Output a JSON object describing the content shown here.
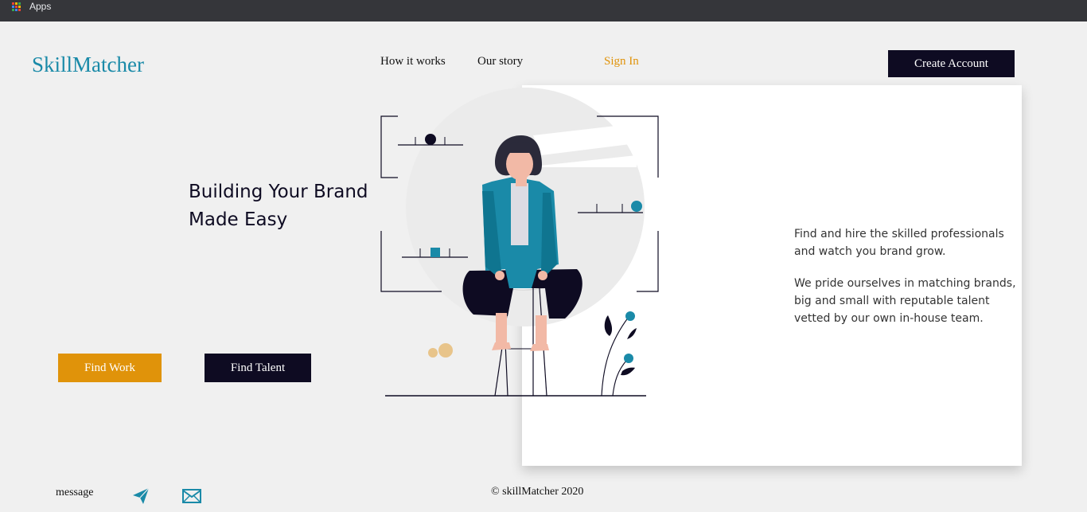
{
  "browser": {
    "apps_label": "Apps"
  },
  "header": {
    "logo": "SkillMatcher",
    "nav": {
      "how": "How it works",
      "story": "Our story",
      "signin": "Sign In"
    },
    "create_account": "Create Account"
  },
  "hero": {
    "headline_1": "Building Your Brand",
    "headline_2": "Made Easy",
    "find_work": "Find Work",
    "find_talent": "Find Talent"
  },
  "panel": {
    "para1": "Find and hire the skilled professionals and watch you brand grow.",
    "para2": "We pride ourselves in matching brands, big and small with reputable talent vetted by our own in-house team."
  },
  "footer": {
    "message": "message",
    "copyright": "© skillMatcher 2020"
  },
  "colors": {
    "brand_teal": "#1a8aa8",
    "accent_orange": "#e0930a",
    "dark_navy": "#0e0b22"
  }
}
